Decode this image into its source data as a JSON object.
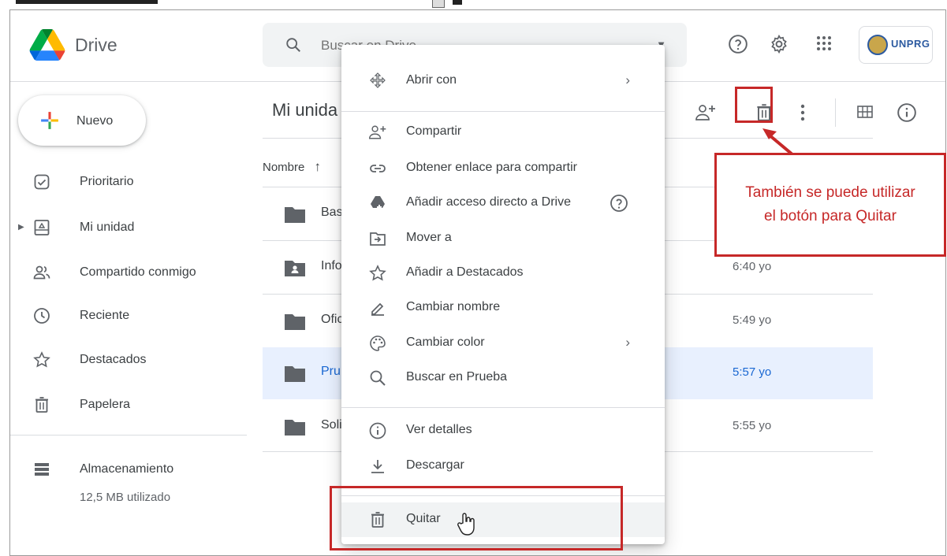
{
  "app": {
    "name": "Drive"
  },
  "search": {
    "placeholder": "Buscar en Drive",
    "caret_icon": "dropdown-caret-icon"
  },
  "top_icons": [
    "help-circle-icon",
    "settings-gear-icon",
    "apps-grid-icon"
  ],
  "account": {
    "label": "UNPRG"
  },
  "new_button": {
    "label": "Nuevo"
  },
  "sidebar": {
    "items": [
      {
        "label": "Prioritario",
        "icon": "priority-check-icon"
      },
      {
        "label": "Mi unidad",
        "icon": "my-drive-icon"
      },
      {
        "label": "Compartido conmigo",
        "icon": "shared-people-icon"
      },
      {
        "label": "Reciente",
        "icon": "clock-icon"
      },
      {
        "label": "Destacados",
        "icon": "star-icon"
      },
      {
        "label": "Papelera",
        "icon": "trash-icon"
      }
    ],
    "storage": {
      "label": "Almacenamiento",
      "used": "12,5 MB utilizado",
      "icon": "storage-icon"
    }
  },
  "main": {
    "breadcrumb": "Mi unida",
    "column_name": "Nombre",
    "files": [
      {
        "name": "Bas",
        "time": ""
      },
      {
        "name": "Info",
        "time": "6:40 yo",
        "shared": true
      },
      {
        "name": "Ofic",
        "time": "5:49 yo"
      },
      {
        "name": "Pru",
        "time": "5:57 yo",
        "selected": true
      },
      {
        "name": "Soli",
        "time": "5:55 yo"
      }
    ]
  },
  "context_menu": {
    "items": [
      {
        "label": "Abrir con",
        "icon": "open-with-icon",
        "submenu": true
      },
      {
        "label": "Compartir",
        "icon": "share-person-add-icon"
      },
      {
        "label": "Obtener enlace para compartir",
        "icon": "link-icon"
      },
      {
        "label": "Añadir acceso directo a Drive",
        "icon": "drive-shortcut-icon",
        "help": true
      },
      {
        "label": "Mover a",
        "icon": "move-to-folder-icon"
      },
      {
        "label": "Añadir a Destacados",
        "icon": "star-icon"
      },
      {
        "label": "Cambiar nombre",
        "icon": "pencil-icon"
      },
      {
        "label": "Cambiar color",
        "icon": "palette-icon",
        "submenu": true
      },
      {
        "label": "Buscar en Prueba",
        "icon": "search-icon"
      },
      {
        "label": "Ver detalles",
        "icon": "info-icon"
      },
      {
        "label": "Descargar",
        "icon": "download-icon"
      },
      {
        "label": "Quitar",
        "icon": "trash-icon",
        "hovered": true
      }
    ]
  },
  "annotation": {
    "line1": "También se puede utilizar",
    "line2": "el botón para Quitar",
    "color": "#c62828"
  }
}
